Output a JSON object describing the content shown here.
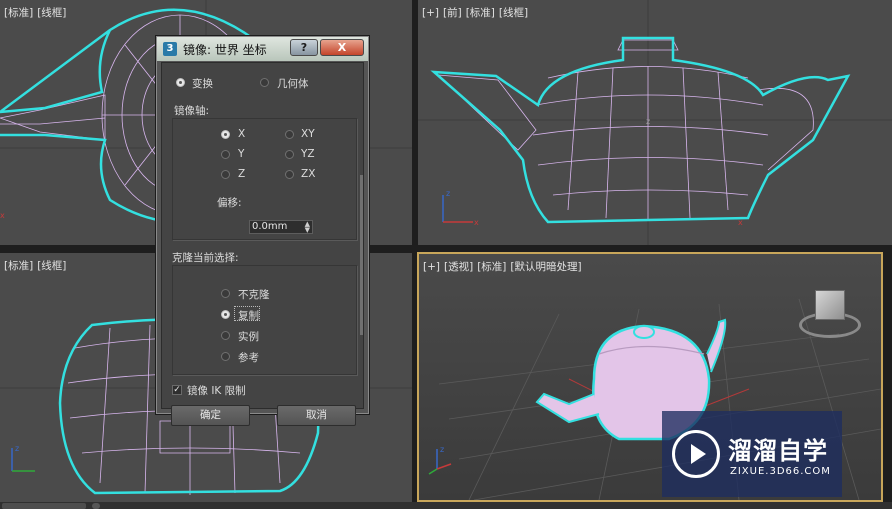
{
  "viewports": {
    "top_left": {
      "labels": [
        "[标准]",
        "[线框]"
      ]
    },
    "front": {
      "labels": [
        "[+]",
        "[前]",
        "[标准]",
        "[线框]"
      ]
    },
    "left": {
      "labels": [
        "[标准]",
        "[线框]"
      ]
    },
    "perspective": {
      "labels": [
        "[+]",
        "[透视]",
        "[标准]",
        "[默认明暗处理]"
      ]
    }
  },
  "dialog": {
    "app_icon": "3",
    "title": "镜像: 世界 坐标",
    "help_label": "?",
    "close_label": "X",
    "mode_options": [
      {
        "label": "变换",
        "selected": true
      },
      {
        "label": "几何体",
        "selected": false
      }
    ],
    "mirror_axis": {
      "title": "镜像轴:",
      "options": [
        {
          "label": "X",
          "selected": true
        },
        {
          "label": "Y",
          "selected": false
        },
        {
          "label": "Z",
          "selected": false
        },
        {
          "label": "XY",
          "selected": false
        },
        {
          "label": "YZ",
          "selected": false
        },
        {
          "label": "ZX",
          "selected": false
        }
      ],
      "offset_label": "偏移:",
      "offset_value": "0.0mm"
    },
    "clone": {
      "title": "克隆当前选择:",
      "options": [
        {
          "label": "不克隆",
          "selected": false
        },
        {
          "label": "复制",
          "selected": true
        },
        {
          "label": "实例",
          "selected": false
        },
        {
          "label": "参考",
          "selected": false
        }
      ]
    },
    "ik_checkbox": {
      "label": "镜像 IK 限制",
      "checked": true
    },
    "ok_label": "确定",
    "cancel_label": "取消"
  },
  "watermark": {
    "title": "溜溜自学",
    "url": "ZIXUE.3D66.COM"
  },
  "colors": {
    "selection_outline": "#33e0e0",
    "wireframe": "#d8b6ee",
    "teapot_shaded": "#e3c5e8",
    "active_viewport_border": "#c8a65a"
  }
}
